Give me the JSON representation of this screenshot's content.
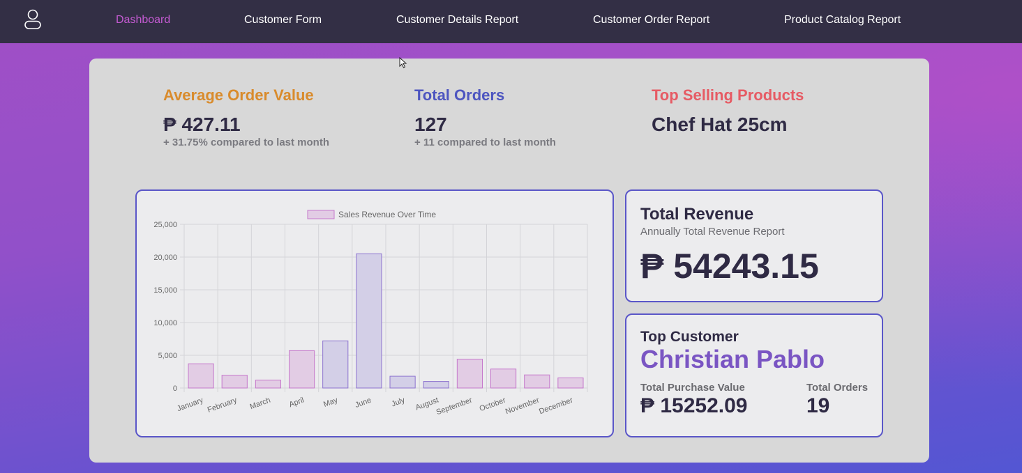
{
  "nav": {
    "user_icon": "user-icon",
    "links": [
      {
        "label": "Dashboard",
        "active": true
      },
      {
        "label": "Customer Form",
        "active": false
      },
      {
        "label": "Customer Details Report",
        "active": false
      },
      {
        "label": "Customer Order Report",
        "active": false
      },
      {
        "label": "Product Catalog Report",
        "active": false
      }
    ]
  },
  "stats": {
    "avg_order": {
      "title": "Average Order Value",
      "value": "₱ 427.11",
      "sub": "+ 31.75% compared to last month",
      "color": "#d98b2c"
    },
    "total_orders": {
      "title": "Total Orders",
      "value": "127",
      "sub": "+ 11 compared to last month",
      "color": "#4d55c0"
    },
    "top_product": {
      "title": "Top Selling Products",
      "value": "Chef Hat 25cm",
      "color": "#e65b64"
    }
  },
  "revenue": {
    "title": "Total Revenue",
    "subtitle": "Annually Total Revenue Report",
    "value": "₱ 54243.15"
  },
  "top_customer": {
    "title": "Top Customer",
    "name": "Christian Pablo",
    "purchase_label": "Total Purchase Value",
    "purchase_value": "₱ 15252.09",
    "orders_label": "Total Orders",
    "orders_value": "19"
  },
  "chart_data": {
    "type": "bar",
    "legend": "Sales Revenue Over Time",
    "categories": [
      "January",
      "February",
      "March",
      "April",
      "May",
      "June",
      "July",
      "August",
      "September",
      "October",
      "November",
      "December"
    ],
    "values": [
      3700,
      1950,
      1200,
      5700,
      7200,
      20500,
      1800,
      1000,
      4400,
      2900,
      2000,
      1550
    ],
    "ylim": [
      0,
      25000
    ],
    "yticks": [
      "0",
      "5,000",
      "10,000",
      "15,000",
      "20,000",
      "25,000"
    ],
    "grid": true,
    "colors": {
      "pink_fill": "#e2cce4",
      "pink_stroke": "#c577cb",
      "lav_fill": "#d3cfe7",
      "lav_stroke": "#8c72cf"
    }
  }
}
